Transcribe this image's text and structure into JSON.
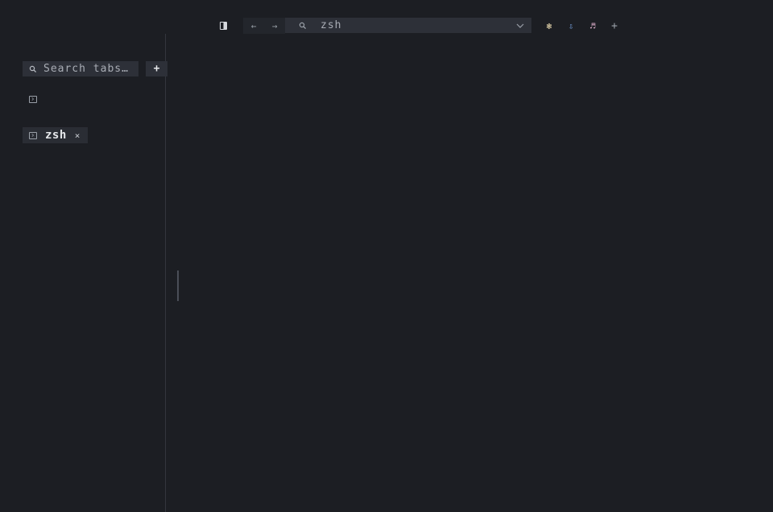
{
  "toolbar": {
    "address_value": "zsh"
  },
  "sidebar": {
    "search_placeholder": "Search tabs…",
    "new_tab_label": "+",
    "tabs": [
      {
        "label": "zsh",
        "close": "×"
      }
    ]
  },
  "icons": {
    "back": "←",
    "forward": "→",
    "search": "⚲",
    "chevron": "⌄",
    "add": "+",
    "extension_1": "❃",
    "extension_2": "⇩",
    "extension_3": "♬"
  },
  "colors": {
    "background": "#1c1e23",
    "field": "#2d3038",
    "text": "#c5c8ce"
  }
}
